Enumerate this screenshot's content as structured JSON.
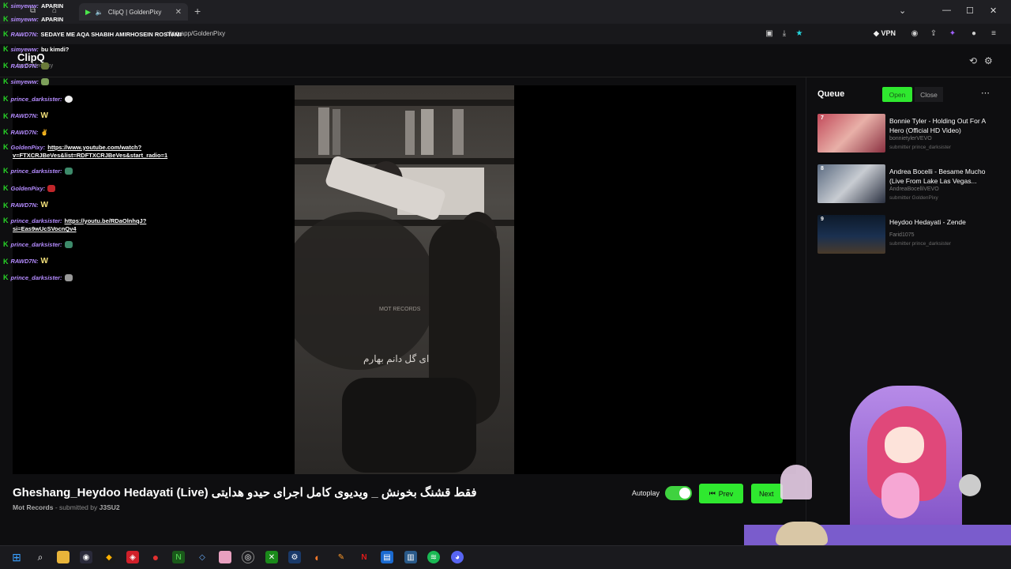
{
  "browser": {
    "tab_title": "ClipQ | GoldenPixy",
    "url": "clipq.app/GoldenPixy",
    "vpn_label": "VPN"
  },
  "app": {
    "name": "ClipQ",
    "subtitle": "by GoldenPixy"
  },
  "chat": [
    {
      "name": "simyeww:",
      "msg": "APARIN"
    },
    {
      "name": "RAWD7N:",
      "msg": "SEDAYE ME AQA SHABIH AMIRHOSEIN ROSTAMI"
    },
    {
      "name": "simyeww:",
      "msg": "bu kimdi?"
    },
    {
      "name": "RAWD7N:",
      "msg": ""
    },
    {
      "name": "simyeww:",
      "msg": ""
    },
    {
      "name": "prince_darksister:",
      "msg": ""
    },
    {
      "name": "RAWD7N:",
      "msg": "W"
    },
    {
      "name": "RAWD7N:",
      "msg": "✌"
    },
    {
      "name": "GoldenPixy:",
      "msg": "https://www.youtube.com/watch?",
      "msg2": "v=FTXCRJBeVes&list=RDFTXCRJBeVes&start_radio=1"
    },
    {
      "name": "prince_darksister:",
      "msg": ""
    },
    {
      "name": "GoldenPixy:",
      "msg": ""
    },
    {
      "name": "RAWD7N:",
      "msg": "W"
    },
    {
      "name": "prince_darksister:",
      "msg": "https://youtu.be/RDaOlnhqJ?",
      "msg2": "si=Eas9wUcSVocnQv4"
    },
    {
      "name": "prince_darksister:",
      "msg": ""
    },
    {
      "name": "RAWD7N:",
      "msg": "W"
    },
    {
      "name": "prince_darksister:",
      "msg": ""
    }
  ],
  "video": {
    "title": "Gheshang_Heydoo Hedayati (Live) فقط قشنگ بخونش _ ویدیوی کامل اجرای حیدو هدایتی",
    "channel": "Mot Records",
    "submitted_prefix": "- submitted by",
    "submitter": "J3SU2",
    "subtitle_text": "ای گل دانم بهارم",
    "watermark": "MOT RECORDS"
  },
  "controls": {
    "autoplay_label": "Autoplay",
    "autoplay_on": true,
    "prev_label": "Prev",
    "next_label": "Next"
  },
  "queue": {
    "title": "Queue",
    "open_label": "Open",
    "close_label": "Close",
    "items": [
      {
        "num": "7",
        "title": "Bonnie Tyler - Holding Out For A Hero (Official HD Video)",
        "channel": "bonnietylerVEVO",
        "submitter": "submitter prince_darksister"
      },
      {
        "num": "8",
        "title": "Andrea Bocelli - Besame Mucho (Live From Lake Las Vegas...",
        "channel": "AndreaBocelliVEVO",
        "submitter": "submitter GoldenPixy"
      },
      {
        "num": "9",
        "title": "Heydoo Hedayati - Zende",
        "channel": "Farid1075",
        "submitter": "submitter prince_darksister"
      }
    ]
  },
  "colors": {
    "accent": "#2fe82f",
    "chat_name": "#b58cff",
    "background": "#0e0e10"
  }
}
